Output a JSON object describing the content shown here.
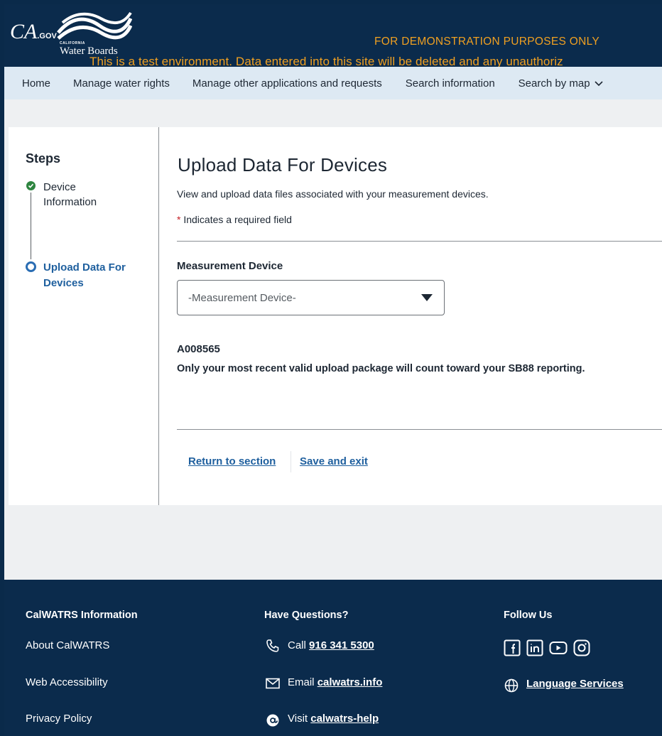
{
  "header": {
    "ca_logo": "CA",
    "ca_gov": ".GOV",
    "org_small": "CALIFORNIA",
    "org_name": "Water Boards",
    "demo_banner": "FOR DEMONSTRATION PURPOSES ONLY",
    "test_banner": "This is a test environment. Data entered into this site will be deleted and any unauthoriz"
  },
  "nav": {
    "items": [
      {
        "label": "Home"
      },
      {
        "label": "Manage water rights"
      },
      {
        "label": "Manage other applications and requests"
      },
      {
        "label": "Search information"
      },
      {
        "label": "Search by map"
      }
    ]
  },
  "sidebar": {
    "title": "Steps",
    "steps": [
      {
        "label": "Device Information",
        "status": "complete"
      },
      {
        "label": "Upload Data For Devices",
        "status": "current"
      }
    ]
  },
  "main": {
    "title": "Upload Data For Devices",
    "description": "View and upload data files associated with your measurement devices.",
    "required_star": "*",
    "required_note": " Indicates a required field",
    "field_label": "Measurement Device",
    "select_placeholder": "-Measurement Device-",
    "account_id": "A008565",
    "sb88_note": "Only your most recent valid upload package will count toward your SB88 reporting.",
    "return_link": "Return to section",
    "save_link": "Save and exit"
  },
  "footer": {
    "col1_head": "CalWATRS Information",
    "col1_items": [
      "About CalWATRS",
      "Web Accessibility",
      "Privacy Policy"
    ],
    "col2_head": "Have Questions?",
    "call_prefix": "Call ",
    "call_value": "916 341 5300",
    "email_prefix": "Email ",
    "email_value": "calwatrs.info",
    "visit_prefix": "Visit ",
    "visit_value": "calwatrs-help",
    "col3_head": "Follow Us",
    "social_icons": [
      "facebook-icon",
      "linkedin-icon",
      "youtube-icon",
      "instagram-icon"
    ],
    "language_services": "Language Services"
  },
  "colors": {
    "header_bg": "#0b2b4c",
    "nav_bg": "#dde9f3",
    "banner": "#f0a021",
    "link": "#1e5f9e",
    "step_complete": "#2e8540",
    "required_star": "#c41e24"
  }
}
